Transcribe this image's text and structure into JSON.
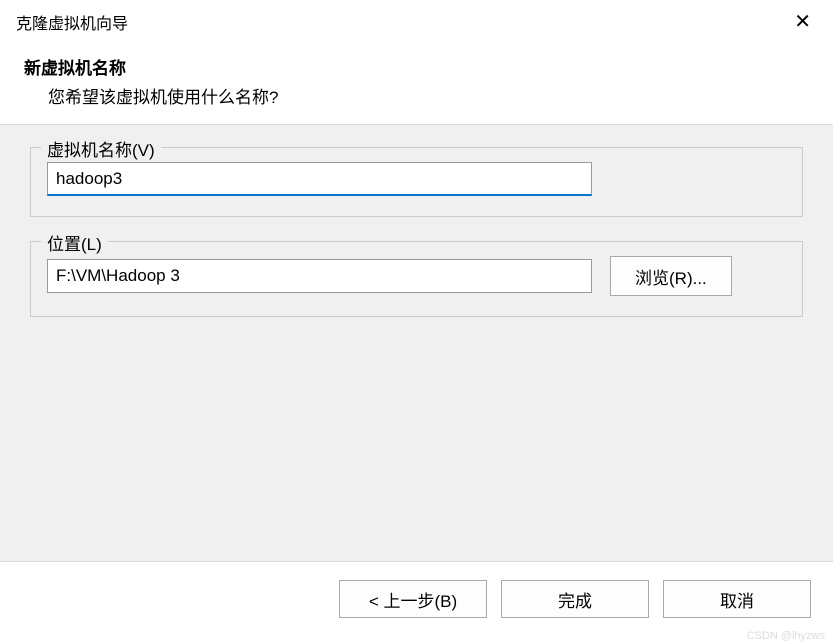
{
  "titlebar": {
    "title": "克隆虚拟机向导"
  },
  "header": {
    "title": "新虚拟机名称",
    "subtitle": "您希望该虚拟机使用什么名称?"
  },
  "form": {
    "name_group": {
      "label": "虚拟机名称(V)",
      "value": "hadoop3"
    },
    "location_group": {
      "label": "位置(L)",
      "value": "F:\\VM\\Hadoop 3",
      "browse_label": "浏览(R)..."
    }
  },
  "footer": {
    "back_label": "< 上一步(B)",
    "finish_label": "完成",
    "cancel_label": "取消"
  },
  "watermark": "CSDN @lhyzws"
}
